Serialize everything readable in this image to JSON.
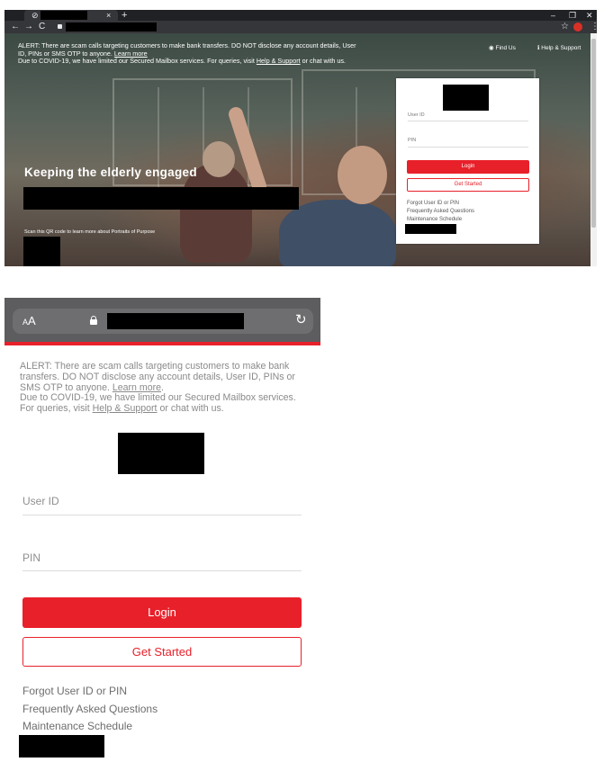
{
  "desktop": {
    "tab_close": "×",
    "tab_new": "+",
    "window_controls": [
      "–",
      "❐",
      "✕"
    ],
    "alert_line1": "ALERT: There are scam calls targeting customers to make bank transfers. DO NOT disclose any account details, User ID, PINs or SMS OTP to anyone. ",
    "alert_link1": "Learn more",
    "alert_line2": "Due to COVID-19, we have limited our Secured Mailbox services. For queries, visit ",
    "alert_link2": "Help & Support",
    "alert_line2_end": " or chat with us.",
    "top_links": [
      "Find Us",
      "Help & Support"
    ],
    "headline": "Keeping the elderly engaged",
    "qr_text": "Scan this QR code to learn more about Portraits of Purpose",
    "login_card": {
      "user_id_label": "User ID",
      "pin_label": "PIN",
      "login_button": "Login",
      "get_started_button": "Get Started",
      "links": [
        "Forgot User ID or PIN",
        "Frequently Asked Questions",
        "Maintenance Schedule"
      ]
    }
  },
  "mobile": {
    "text_size_label_small": "A",
    "text_size_label_large": "A",
    "reload_icon": "↻",
    "alert_line1": "ALERT: There are scam calls targeting customers to make bank transfers. DO NOT disclose any account details, User ID, PINs or SMS OTP to anyone. ",
    "alert_link1": "Learn more",
    "alert_link1_end": ".",
    "alert_line2": "Due to COVID-19, we have limited our Secured Mailbox services. For queries, visit ",
    "alert_link2": "Help & Support",
    "alert_line2_end": " or chat with us.",
    "user_id_label": "User ID",
    "pin_label": "PIN",
    "login_button": "Login",
    "get_started_button": "Get Started",
    "links": [
      "Forgot User ID or PIN",
      "Frequently Asked Questions",
      "Maintenance Schedule"
    ]
  },
  "colors": {
    "accent_red": "#e8202a",
    "mobile_bar": "#5d5d5f",
    "chrome_dark": "#202124"
  }
}
